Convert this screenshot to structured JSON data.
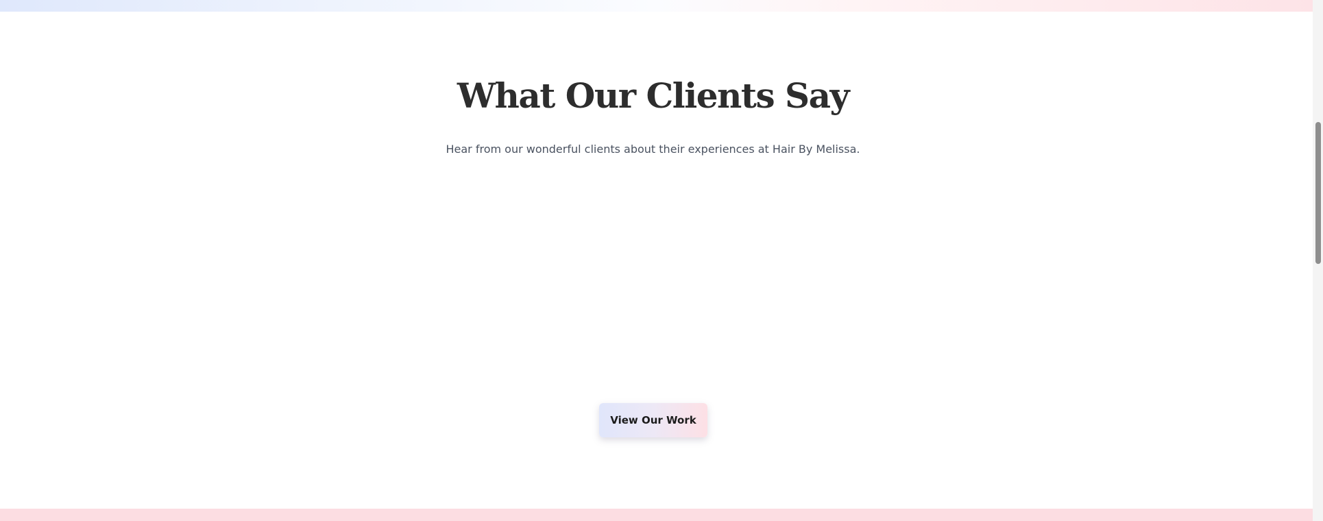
{
  "testimonials": {
    "title": "What Our Clients Say",
    "subtitle": "Hear from our wonderful clients about their experiences at Hair By Melissa.",
    "cta_label": "View Our Work"
  },
  "colors": {
    "heading": "#2d2d2d",
    "subtitle": "#4a5260",
    "button_gradient_start": "#e0e6fb",
    "button_gradient_end": "#fde0e5",
    "band_pink": "#fcdde2",
    "band_blue": "#dfe8fc"
  }
}
